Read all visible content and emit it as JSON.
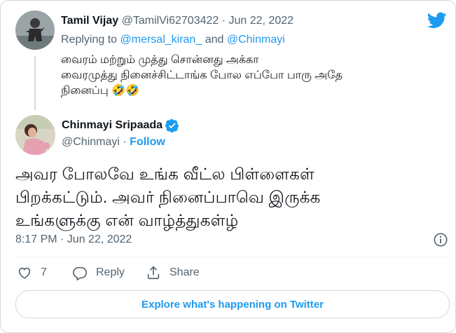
{
  "reply": {
    "name": "Tamil Vijay",
    "handle": "@TamilVi62703422",
    "separator": "·",
    "date": "Jun 22, 2022",
    "replying_prefix": "Replying to",
    "replying_to_1": "@mersal_kiran_",
    "replying_and": "and",
    "replying_to_2": "@Chinmayi",
    "line1": "வைரம் மற்றும் முத்து சொன்னது அக்கா",
    "line2": "வைரமுத்து நினைச்சிட்டாங்க போல எப்போ பாரு அதே",
    "line3": "நினைப்பு 🤣🤣"
  },
  "main": {
    "name": "Chinmayi Sripaada",
    "handle": "@Chinmayi",
    "separator": "·",
    "follow_label": "Follow",
    "text_line1": "அவர போலவே உங்க வீட்ல பிள்ளைகள்",
    "text_line2": "பிறக்கட்டும். அவர் நினைப்பாவெ இருக்க",
    "text_line3": "உங்களுக்கு என் வாழ்த்துகள்ழ்",
    "timestamp": "8:17 PM · Jun 22, 2022"
  },
  "actions": {
    "like_count": "7",
    "reply_label": "Reply",
    "share_label": "Share"
  },
  "explore_label": "Explore what's happening on Twitter",
  "icons": [
    "twitter-bird-icon",
    "verified-badge-icon",
    "info-icon",
    "heart-icon",
    "reply-icon",
    "share-icon"
  ],
  "colors": {
    "accent": "#1d9bf0",
    "text": "#0f1419",
    "muted": "#536471",
    "border": "#cfd9de"
  }
}
